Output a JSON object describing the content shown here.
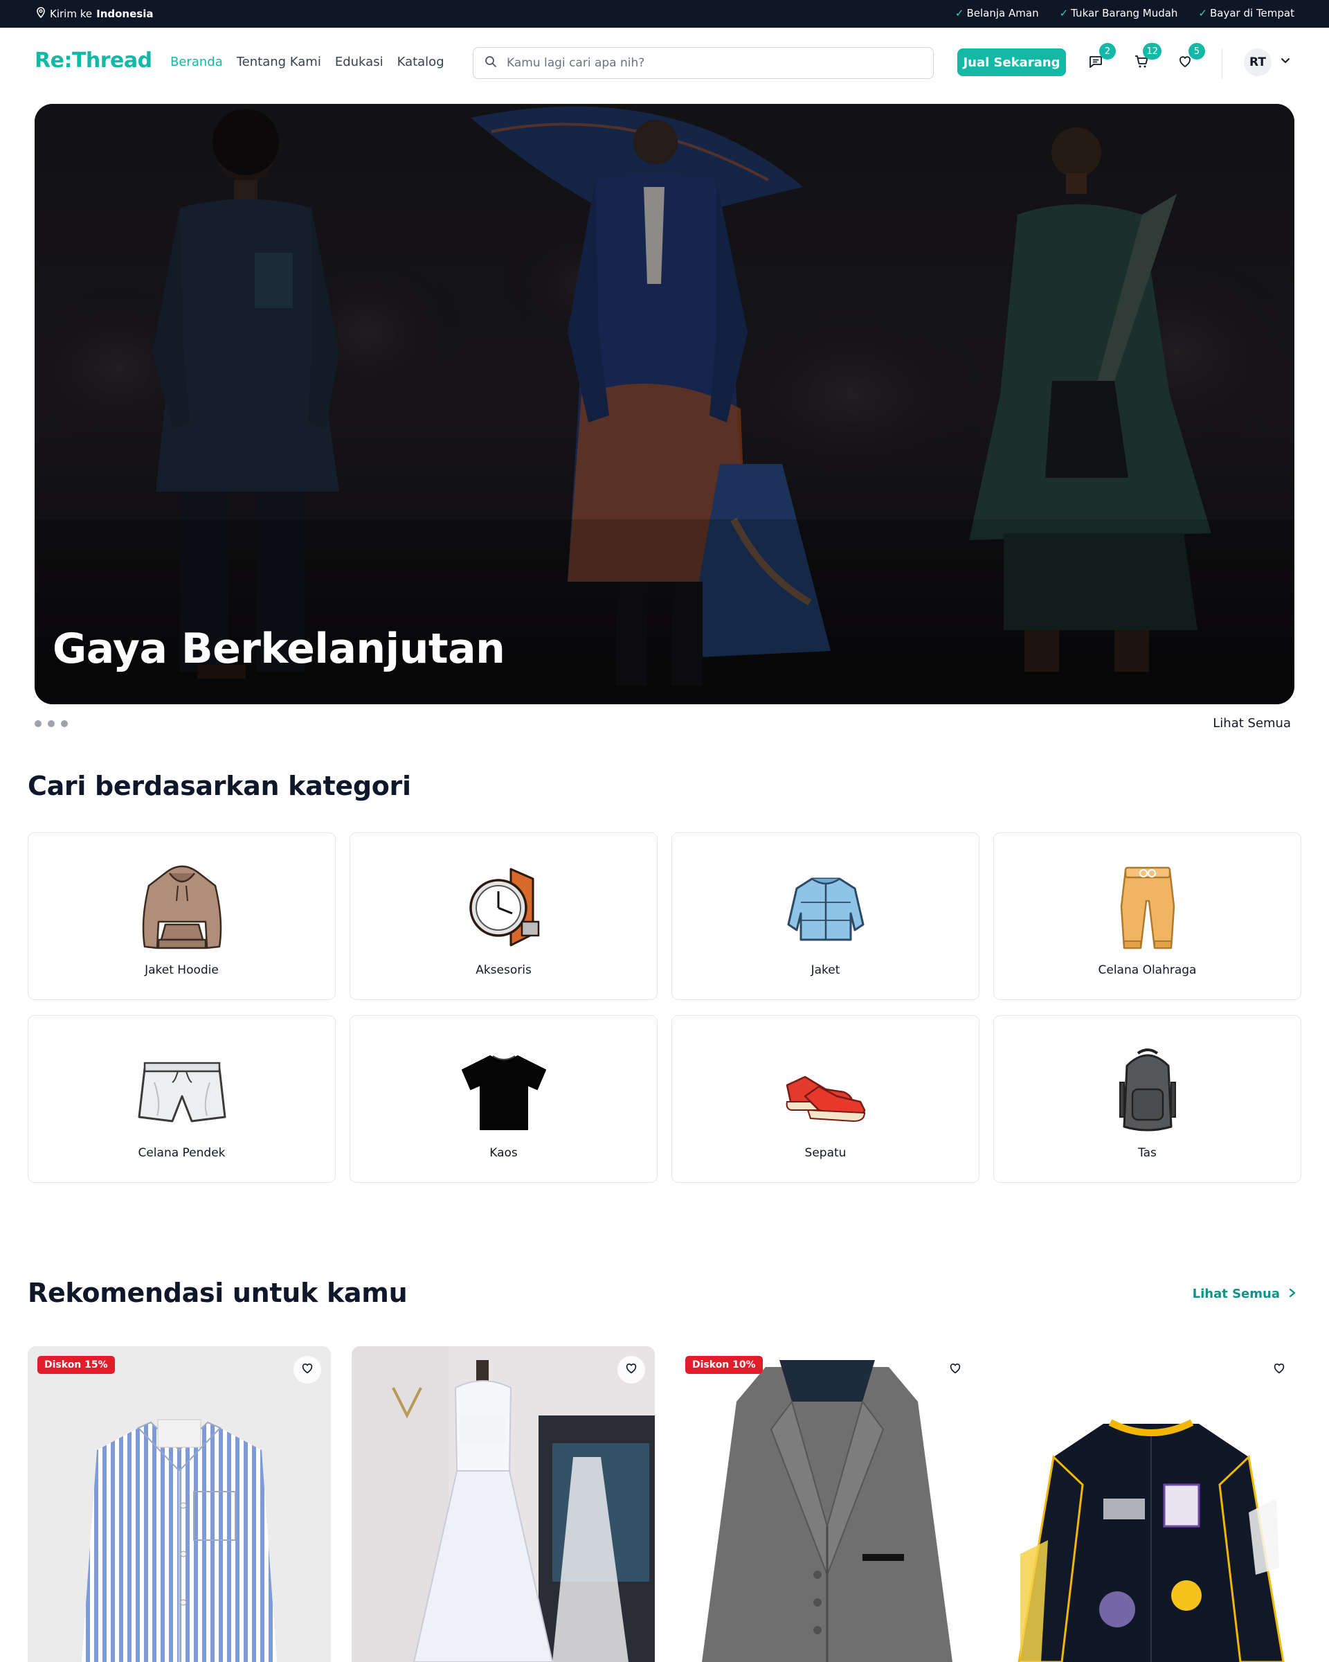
{
  "topbar": {
    "ship_prefix": "Kirim ke",
    "ship_location": "Indonesia",
    "perks": [
      "Belanja Aman",
      "Tukar Barang Mudah",
      "Bayar di Tempat"
    ]
  },
  "header": {
    "logo": "Re:Thread",
    "nav": [
      "Beranda",
      "Tentang Kami",
      "Edukasi",
      "Katalog"
    ],
    "search_placeholder": "Kamu lagi cari apa nih?",
    "sell_label": "Jual Sekarang",
    "badges": {
      "chat": "2",
      "cart": "12",
      "wishlist": "5"
    },
    "avatar_initials": "RT"
  },
  "hero": {
    "title": "Gaya Berkelanjutan",
    "see_all": "Lihat Semua"
  },
  "categories": {
    "title": "Cari berdasarkan kategori",
    "items": [
      {
        "label": "Jaket Hoodie",
        "icon": "hoodie-icon"
      },
      {
        "label": "Aksesoris",
        "icon": "watch-icon"
      },
      {
        "label": "Jaket",
        "icon": "jacket-icon"
      },
      {
        "label": "Celana Olahraga",
        "icon": "sweatpants-icon"
      },
      {
        "label": "Celana Pendek",
        "icon": "shorts-icon"
      },
      {
        "label": "Kaos",
        "icon": "tshirt-icon"
      },
      {
        "label": "Sepatu",
        "icon": "sneakers-icon"
      },
      {
        "label": "Tas",
        "icon": "backpack-icon"
      }
    ]
  },
  "recommendations": {
    "title": "Rekomendasi untuk kamu",
    "see_all": "Lihat Semua",
    "products": [
      {
        "discount": "Diskon 15%",
        "image": "striped-shirt"
      },
      {
        "discount": "",
        "image": "white-gown"
      },
      {
        "discount": "Diskon 10%",
        "image": "grey-blazer"
      },
      {
        "discount": "",
        "image": "varsity-jacket"
      }
    ]
  },
  "colors": {
    "accent": "#14b8a6",
    "topbar": "#0f1626",
    "discount": "#e11d2a"
  }
}
